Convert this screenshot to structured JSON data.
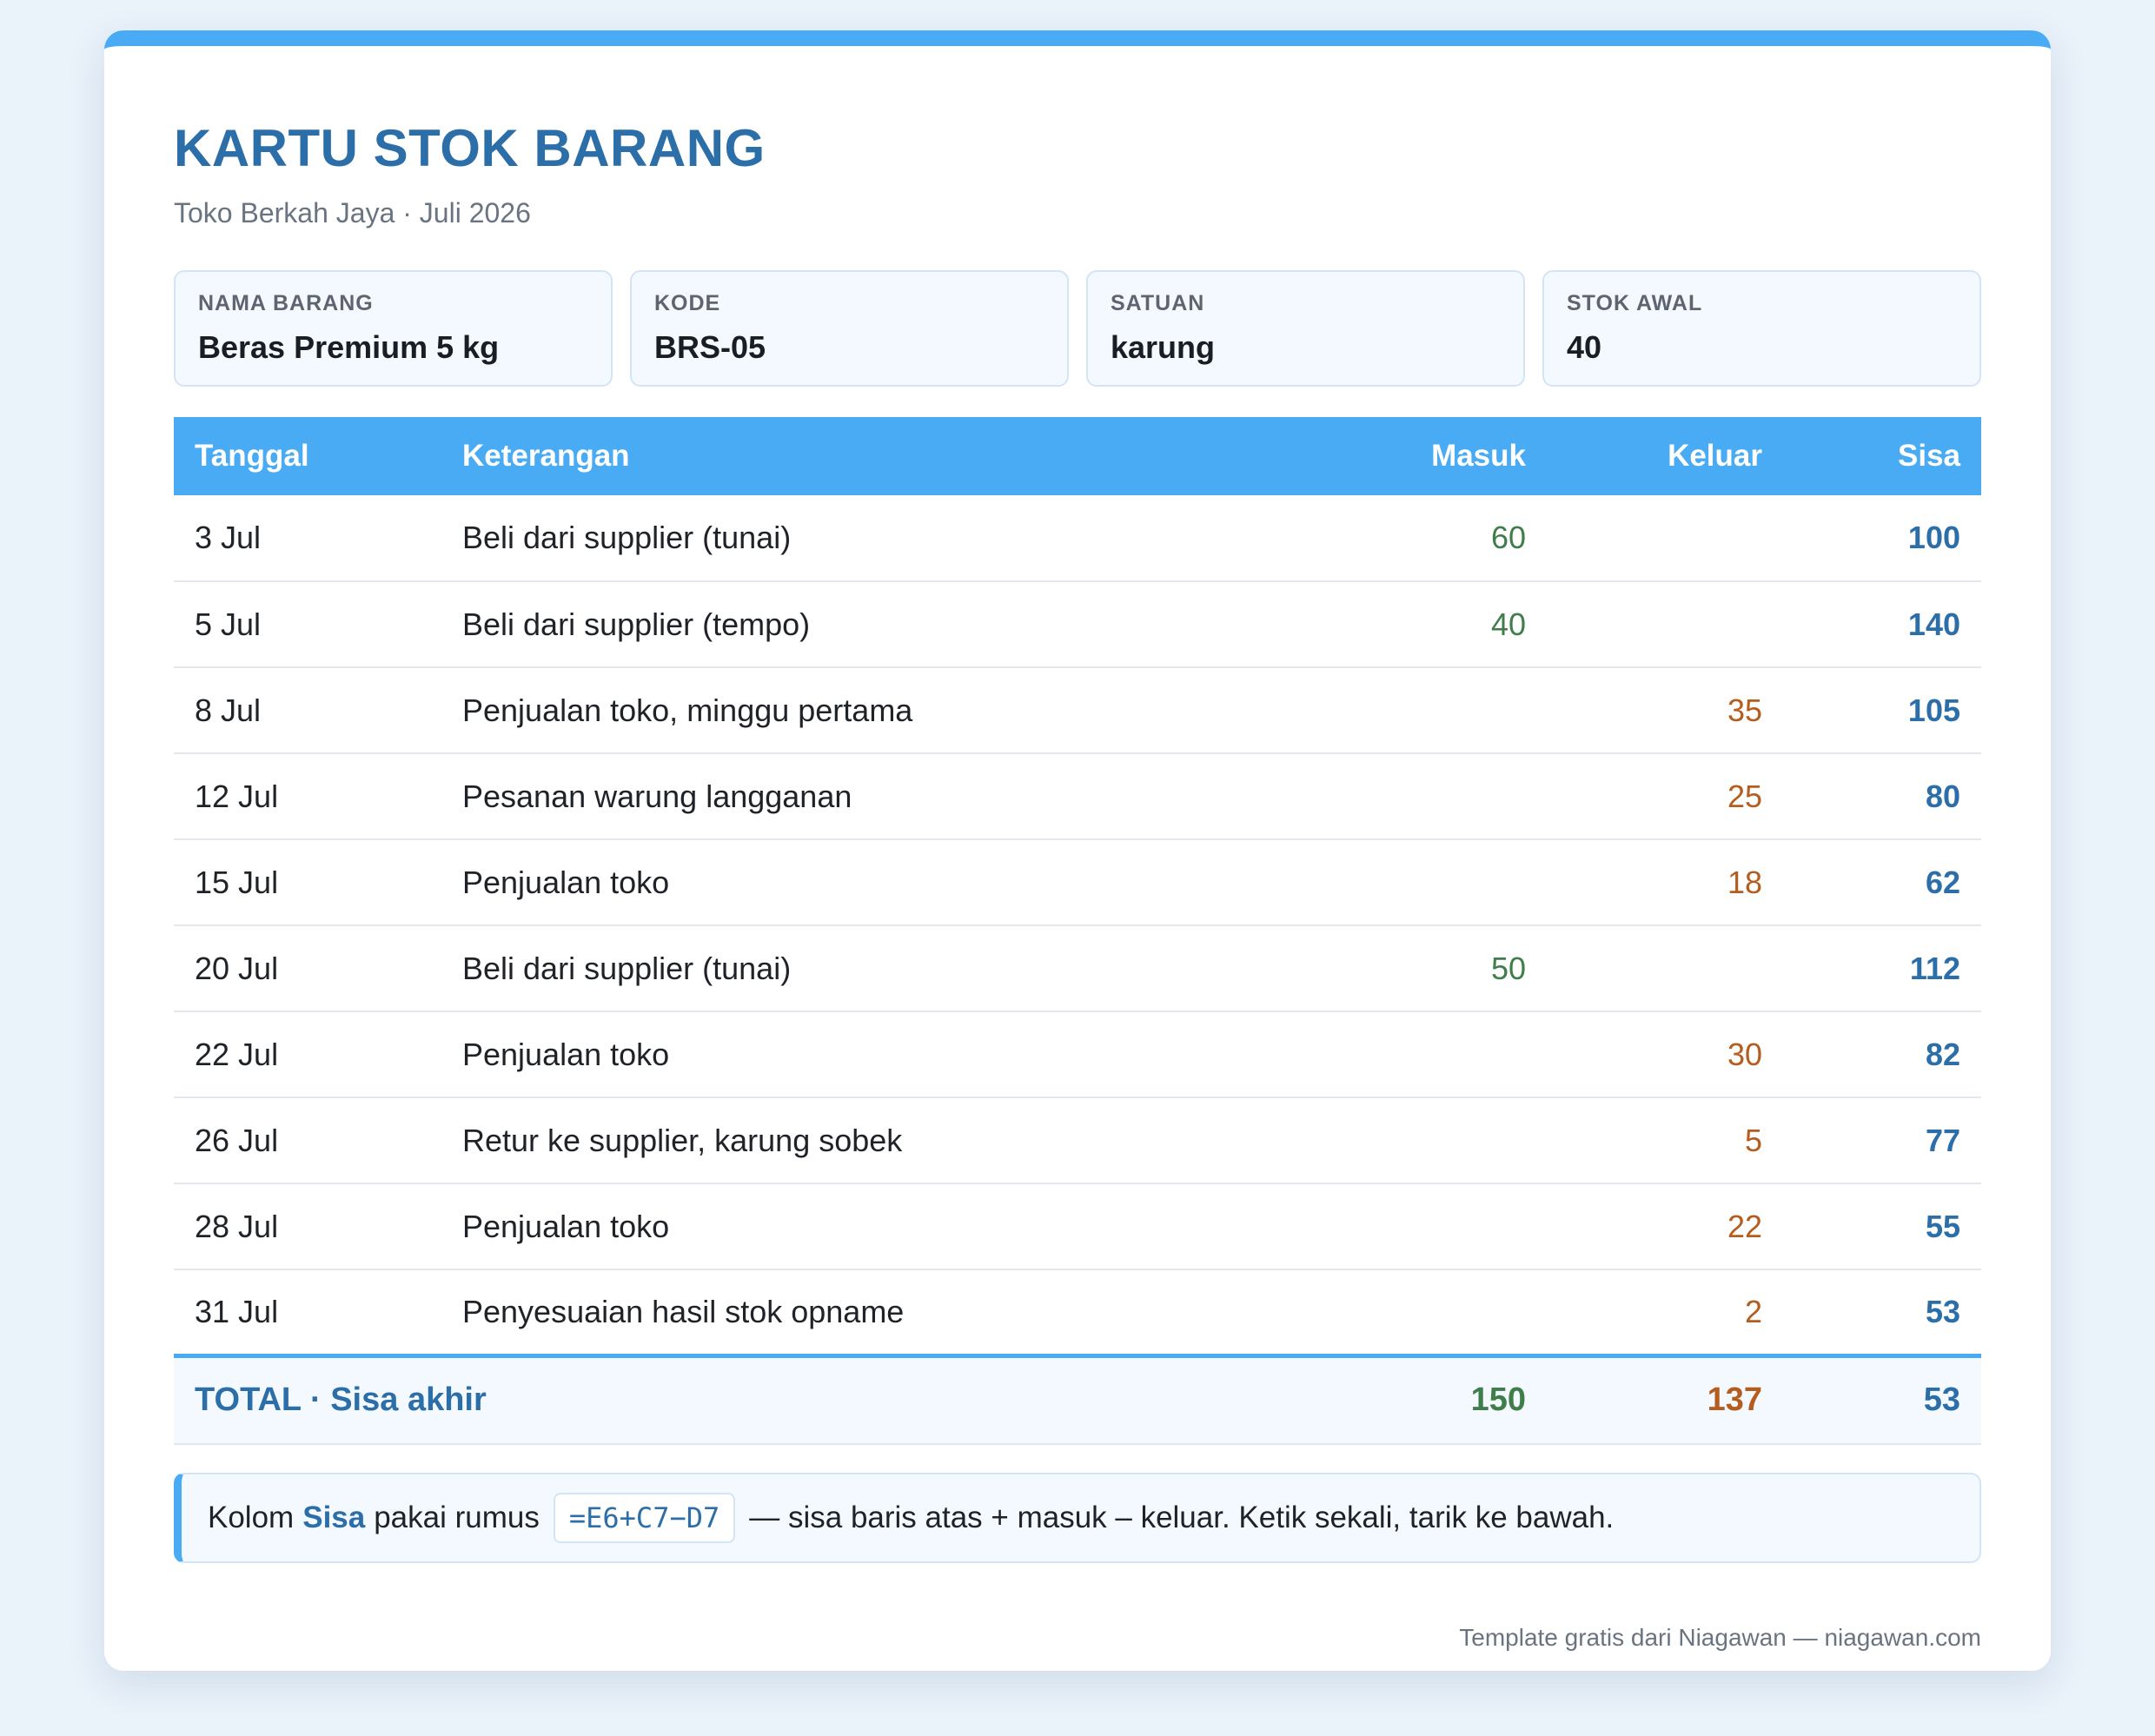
{
  "header": {
    "title": "KARTU STOK BARANG",
    "subtitle": "Toko Berkah Jaya · Juli 2026"
  },
  "meta": [
    {
      "label": "NAMA BARANG",
      "value": "Beras Premium 5 kg"
    },
    {
      "label": "KODE",
      "value": "BRS-05"
    },
    {
      "label": "SATUAN",
      "value": "karung"
    },
    {
      "label": "STOK AWAL",
      "value": "40"
    }
  ],
  "table": {
    "headers": {
      "date": "Tanggal",
      "desc": "Keterangan",
      "in": "Masuk",
      "out": "Keluar",
      "balance": "Sisa"
    },
    "rows": [
      {
        "date": "3 Jul",
        "desc": "Beli dari supplier (tunai)",
        "in": "60",
        "out": "",
        "balance": "100"
      },
      {
        "date": "5 Jul",
        "desc": "Beli dari supplier (tempo)",
        "in": "40",
        "out": "",
        "balance": "140"
      },
      {
        "date": "8 Jul",
        "desc": "Penjualan toko, minggu pertama",
        "in": "",
        "out": "35",
        "balance": "105"
      },
      {
        "date": "12 Jul",
        "desc": "Pesanan warung langganan",
        "in": "",
        "out": "25",
        "balance": "80"
      },
      {
        "date": "15 Jul",
        "desc": "Penjualan toko",
        "in": "",
        "out": "18",
        "balance": "62"
      },
      {
        "date": "20 Jul",
        "desc": "Beli dari supplier (tunai)",
        "in": "50",
        "out": "",
        "balance": "112"
      },
      {
        "date": "22 Jul",
        "desc": "Penjualan toko",
        "in": "",
        "out": "30",
        "balance": "82"
      },
      {
        "date": "26 Jul",
        "desc": "Retur ke supplier, karung sobek",
        "in": "",
        "out": "5",
        "balance": "77"
      },
      {
        "date": "28 Jul",
        "desc": "Penjualan toko",
        "in": "",
        "out": "22",
        "balance": "55"
      },
      {
        "date": "31 Jul",
        "desc": "Penyesuaian hasil stok opname",
        "in": "",
        "out": "2",
        "balance": "53"
      }
    ],
    "total": {
      "label": "TOTAL · Sisa akhir",
      "in": "150",
      "out": "137",
      "balance": "53"
    }
  },
  "note": {
    "prefix": "Kolom",
    "highlight": "Sisa",
    "middle": "pakai rumus",
    "formula": "=E6+C7−D7",
    "suffix": "— sisa baris atas + masuk – keluar. Ketik sekali, tarik ke bawah."
  },
  "footer": {
    "text": "Template gratis dari Niagawan — niagawan.com"
  },
  "colors": {
    "accent": "#4aabf5",
    "title": "#2c6ea8",
    "in": "#3f7d4a",
    "out": "#b55c1f"
  }
}
